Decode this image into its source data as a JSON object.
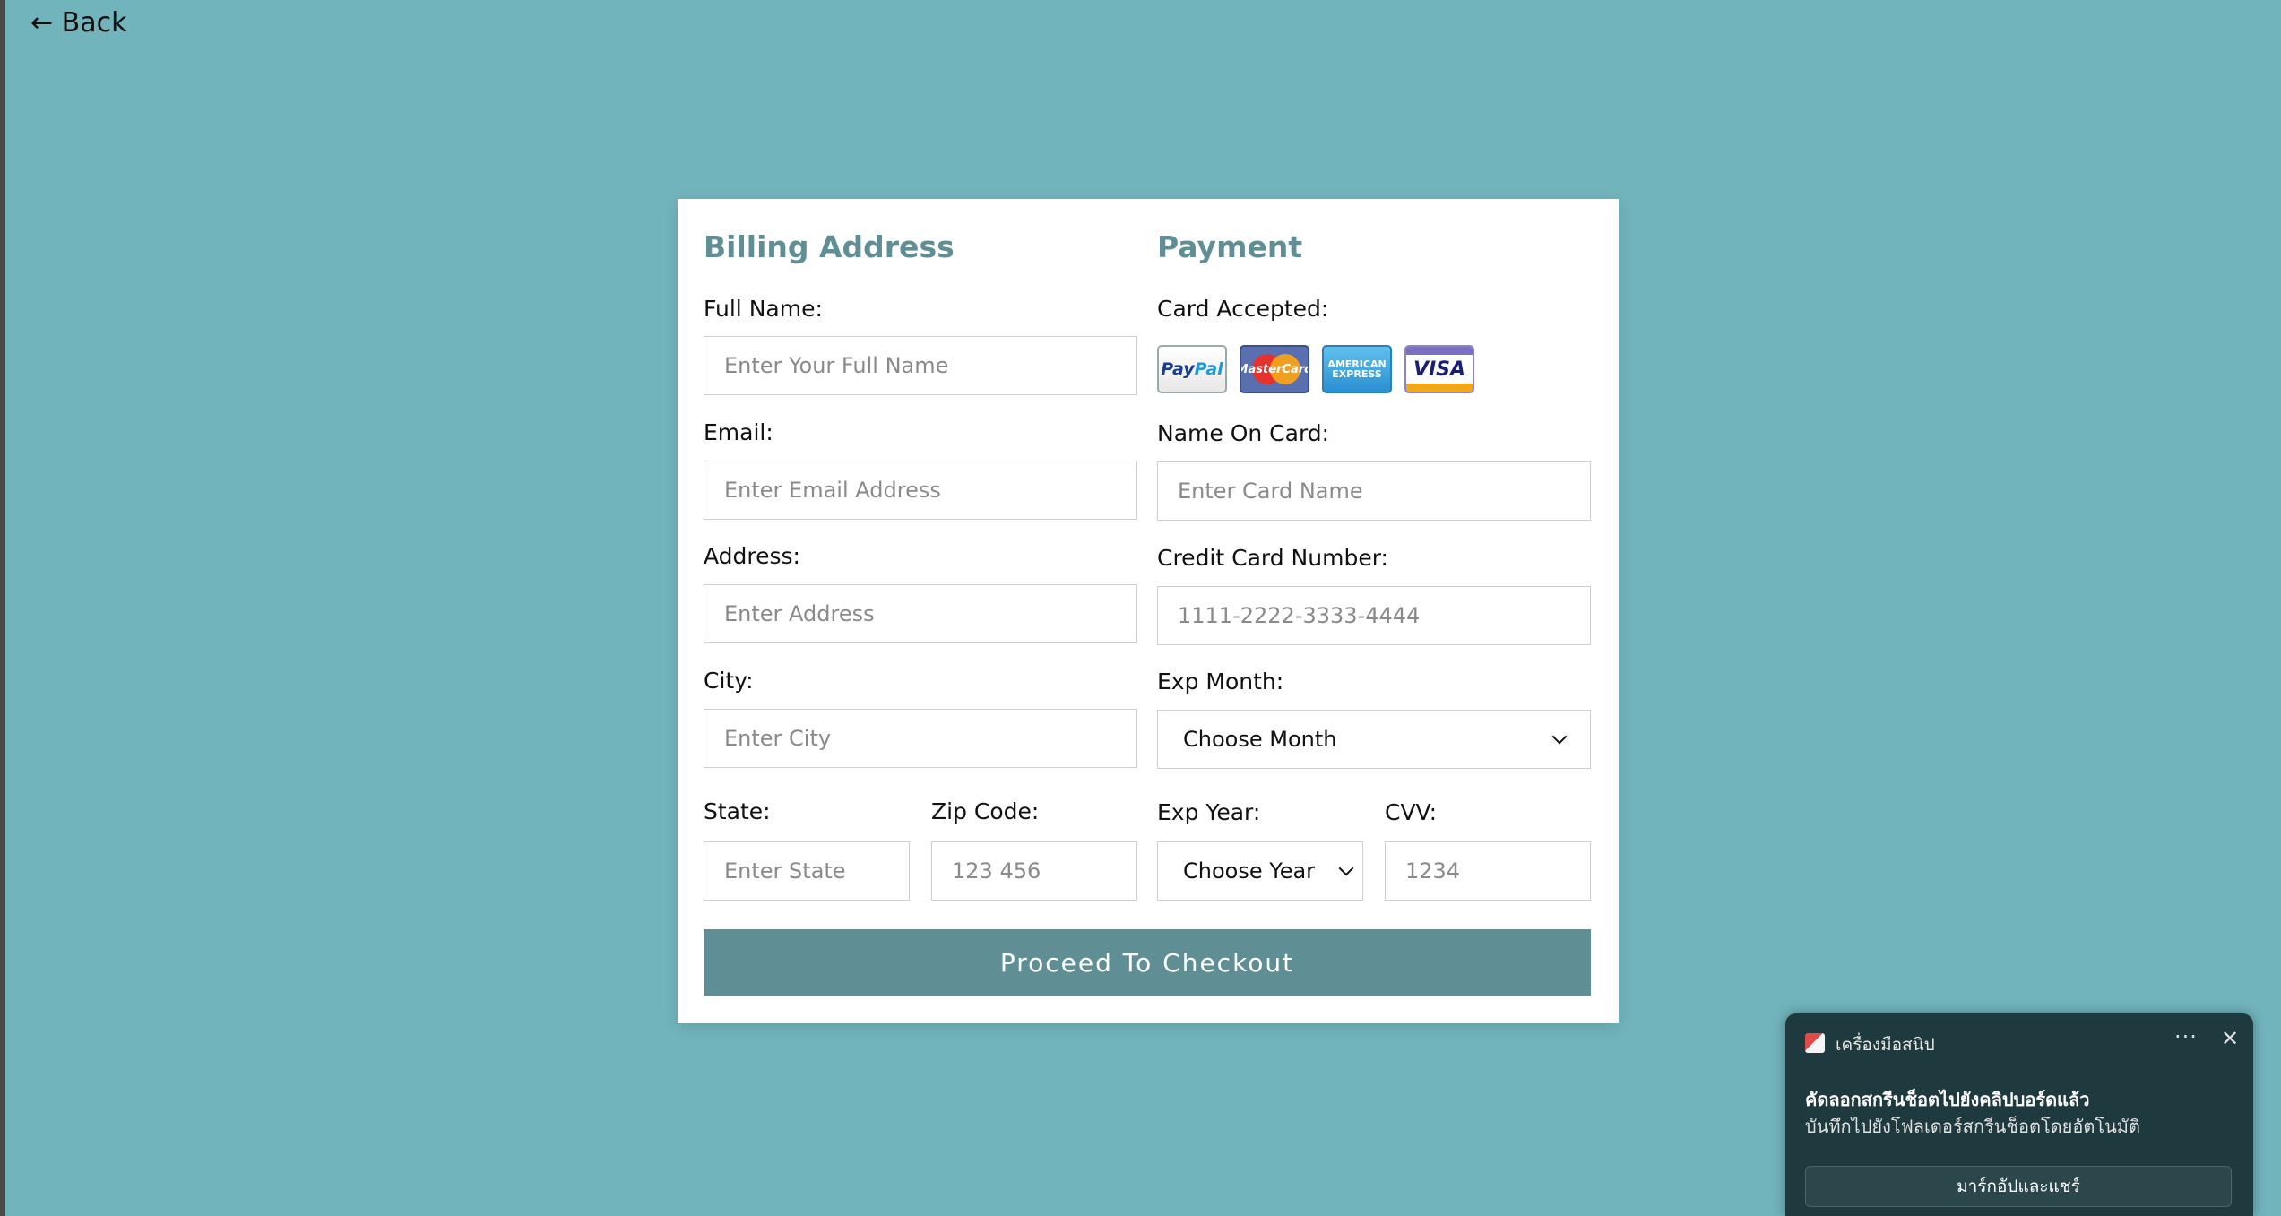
{
  "nav": {
    "back_label": "← Back"
  },
  "billing": {
    "title": "Billing Address",
    "full_name": {
      "label": "Full Name:",
      "placeholder": "Enter Your Full Name"
    },
    "email": {
      "label": "Email:",
      "placeholder": "Enter Email Address"
    },
    "address": {
      "label": "Address:",
      "placeholder": "Enter Address"
    },
    "city": {
      "label": "City:",
      "placeholder": "Enter City"
    },
    "state": {
      "label": "State:",
      "placeholder": "Enter State"
    },
    "zip": {
      "label": "Zip Code:",
      "placeholder": "123 456"
    }
  },
  "payment": {
    "title": "Payment",
    "cards_label": "Card Accepted:",
    "cards": {
      "paypal_a": "Pay",
      "paypal_b": "Pal",
      "mastercard": "MasterCard",
      "amex_a": "AMERICAN",
      "amex_b": "EXPRESS",
      "visa": "VISA"
    },
    "name_on_card": {
      "label": "Name On Card:",
      "placeholder": "Enter Card Name"
    },
    "card_number": {
      "label": "Credit Card Number:",
      "placeholder": "1111-2222-3333-4444"
    },
    "exp_month": {
      "label": "Exp Month:",
      "selected": "Choose Month"
    },
    "exp_year": {
      "label": "Exp Year:",
      "selected": "Choose Year"
    },
    "cvv": {
      "label": "CVV:",
      "placeholder": "1234"
    }
  },
  "checkout": {
    "button_label": "Proceed To Checkout"
  },
  "toast": {
    "app_name": "เครื่องมือสนิป",
    "more": "···",
    "close": "✕",
    "title": "คัดลอกสกรีนช็อตไปยังคลิปบอร์ดแล้ว",
    "subtitle": "บันทึกไปยังโฟลเดอร์สกรีนช็อตโดยอัตโนมัติ",
    "action": "มาร์กอัปและแชร์"
  },
  "colors": {
    "background": "#72b4bc",
    "accent": "#5f8f95",
    "toast_bg": "#1f3a3f"
  }
}
